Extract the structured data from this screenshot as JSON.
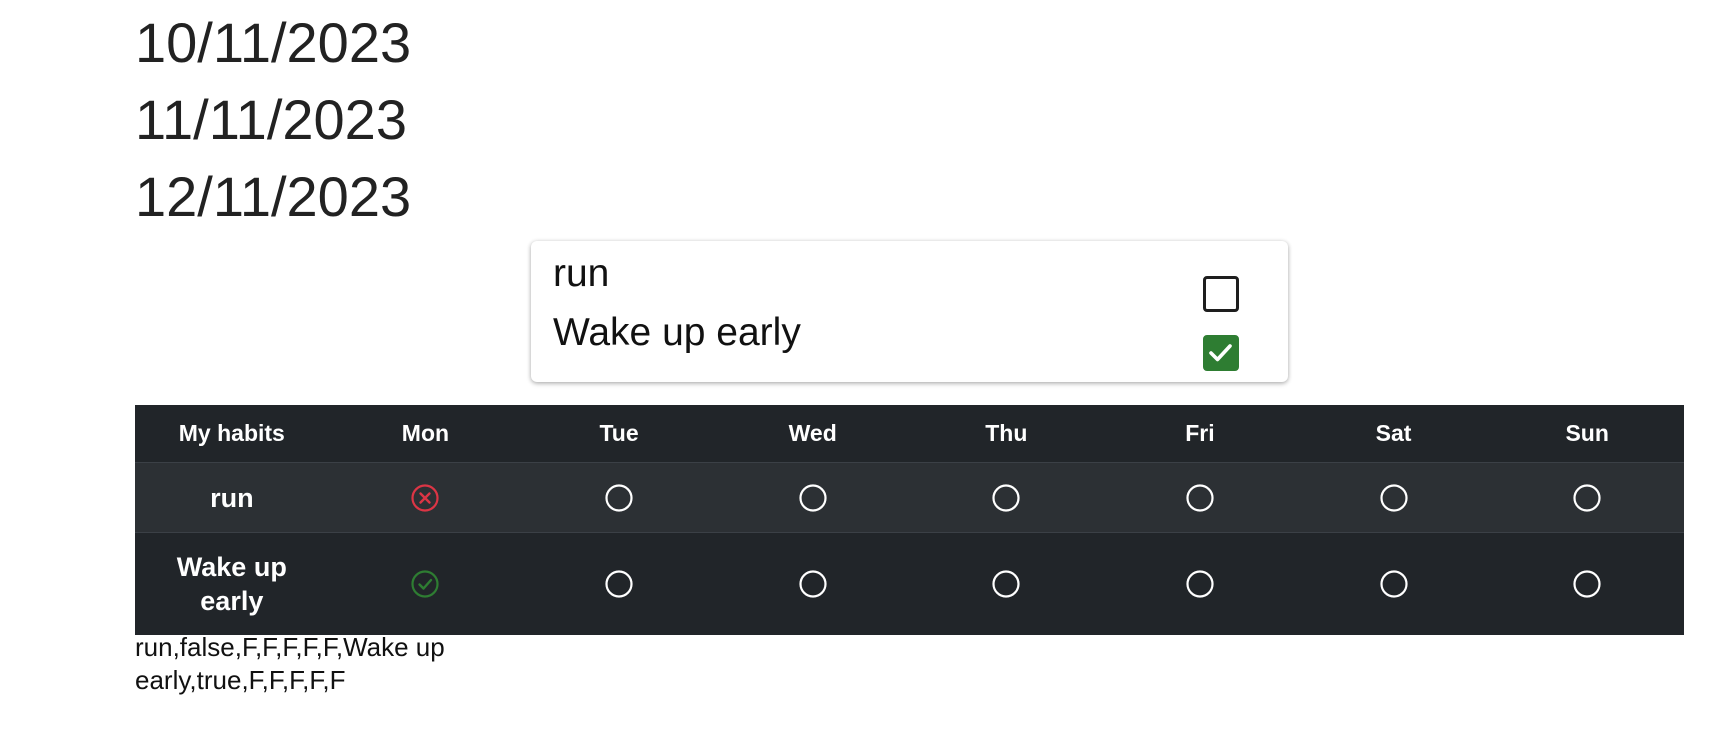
{
  "dates": [
    "10/11/2023",
    "11/11/2023",
    "12/11/2023"
  ],
  "daily_card": {
    "habits": [
      {
        "name": "run",
        "checked": false
      },
      {
        "name": "Wake up early",
        "checked": true
      }
    ]
  },
  "table": {
    "headers": [
      "My habits",
      "Mon",
      "Tue",
      "Wed",
      "Thu",
      "Fri",
      "Sat",
      "Sun"
    ],
    "rows": [
      {
        "habit": "run",
        "status": [
          "missed",
          "empty",
          "empty",
          "empty",
          "empty",
          "empty",
          "empty"
        ]
      },
      {
        "habit": "Wake up early",
        "status": [
          "done",
          "empty",
          "empty",
          "empty",
          "empty",
          "empty",
          "empty"
        ]
      }
    ]
  },
  "csv_output": "run,false,F,F,F,F,F,Wake up early,true,F,F,F,F,F",
  "colors": {
    "done": "#2e7d32",
    "missed": "#dc3545",
    "table_bg": "#212529",
    "table_stripe": "#2c3034"
  }
}
